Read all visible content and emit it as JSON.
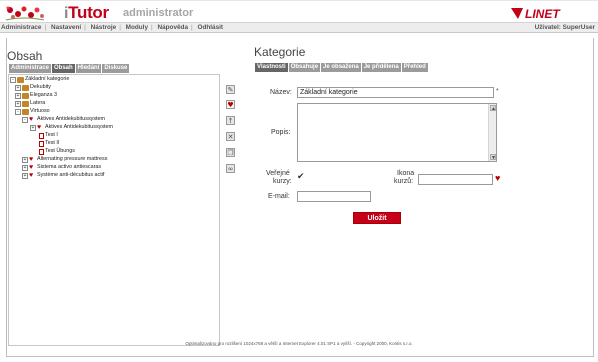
{
  "header": {
    "app_name_prefix": "i",
    "app_name": "Tutor",
    "app_subtitle": "administrator",
    "brand": "LINET",
    "brand_color": "#c3001a"
  },
  "menu": {
    "items": [
      "Administrace",
      "Nastavení",
      "Nástroje",
      "Moduly",
      "Nápověda",
      "Odhlásit"
    ],
    "user_label": "Uživatel:",
    "user_name": "SuperUser"
  },
  "left": {
    "title": "Obsah",
    "tabs": [
      "Administrace",
      "Obsah",
      "Hledání",
      "Diskuse"
    ],
    "active_tab": "Obsah",
    "tree": [
      {
        "label": "Základní kategorie",
        "icon": "folder-icon",
        "toggle": "-"
      },
      {
        "label": "Dekubity",
        "icon": "folder-icon",
        "toggle": "+"
      },
      {
        "label": "Eleganza 3",
        "icon": "folder-icon",
        "toggle": "+"
      },
      {
        "label": "Latera",
        "icon": "folder-icon",
        "toggle": "+"
      },
      {
        "label": "Virtuoso",
        "icon": "folder-icon",
        "toggle": "-"
      },
      {
        "label": "Aktives Antidekubitussystem",
        "icon": "heart-icon",
        "toggle": "-"
      },
      {
        "label": "Aktives Antidekubitussystem",
        "icon": "heart-icon",
        "toggle": "+"
      },
      {
        "label": "Test I",
        "icon": "document-icon",
        "toggle": ""
      },
      {
        "label": "Test II",
        "icon": "document-icon",
        "toggle": ""
      },
      {
        "label": "Test Übungs",
        "icon": "document-icon",
        "toggle": ""
      },
      {
        "label": "Alternating pressure mattress",
        "icon": "heart-icon",
        "toggle": "+"
      },
      {
        "label": "Sistema activo antiescaras",
        "icon": "heart-icon",
        "toggle": "+"
      },
      {
        "label": "Système anti-décubitus actif",
        "icon": "heart-icon",
        "toggle": "+"
      }
    ]
  },
  "toolbar": {
    "icons": [
      "edit-icon",
      "favourite-icon",
      "move-up-icon",
      "delete-icon",
      "copy-icon",
      "binoculars-icon"
    ]
  },
  "right": {
    "title": "Kategorie",
    "tabs": [
      "Vlastnosti",
      "Obsahuje",
      "Je obsažena",
      "Je přidělena",
      "Přehled"
    ],
    "active_tab": "Vlastnosti",
    "form": {
      "name_label": "Název:",
      "name_value": "Základní kategorie",
      "required_mark": "*",
      "description_label": "Popis:",
      "description_value": "",
      "public_label_1": "Veřejné",
      "public_label_2": "kurzy:",
      "public_checked": "✔",
      "icon_label_1": "Ikona",
      "icon_label_2": "kurzů:",
      "icon_value": "",
      "email_label": "E-mail:",
      "email_value": "",
      "save_label": "Uložit"
    }
  },
  "footer": {
    "text": "Optimalizováno pro rozlišení 1024x768 a větší a Internet Explorer 4.01 SP1 a vyšší. - Copyright 2000, Kontis s.r.o."
  }
}
